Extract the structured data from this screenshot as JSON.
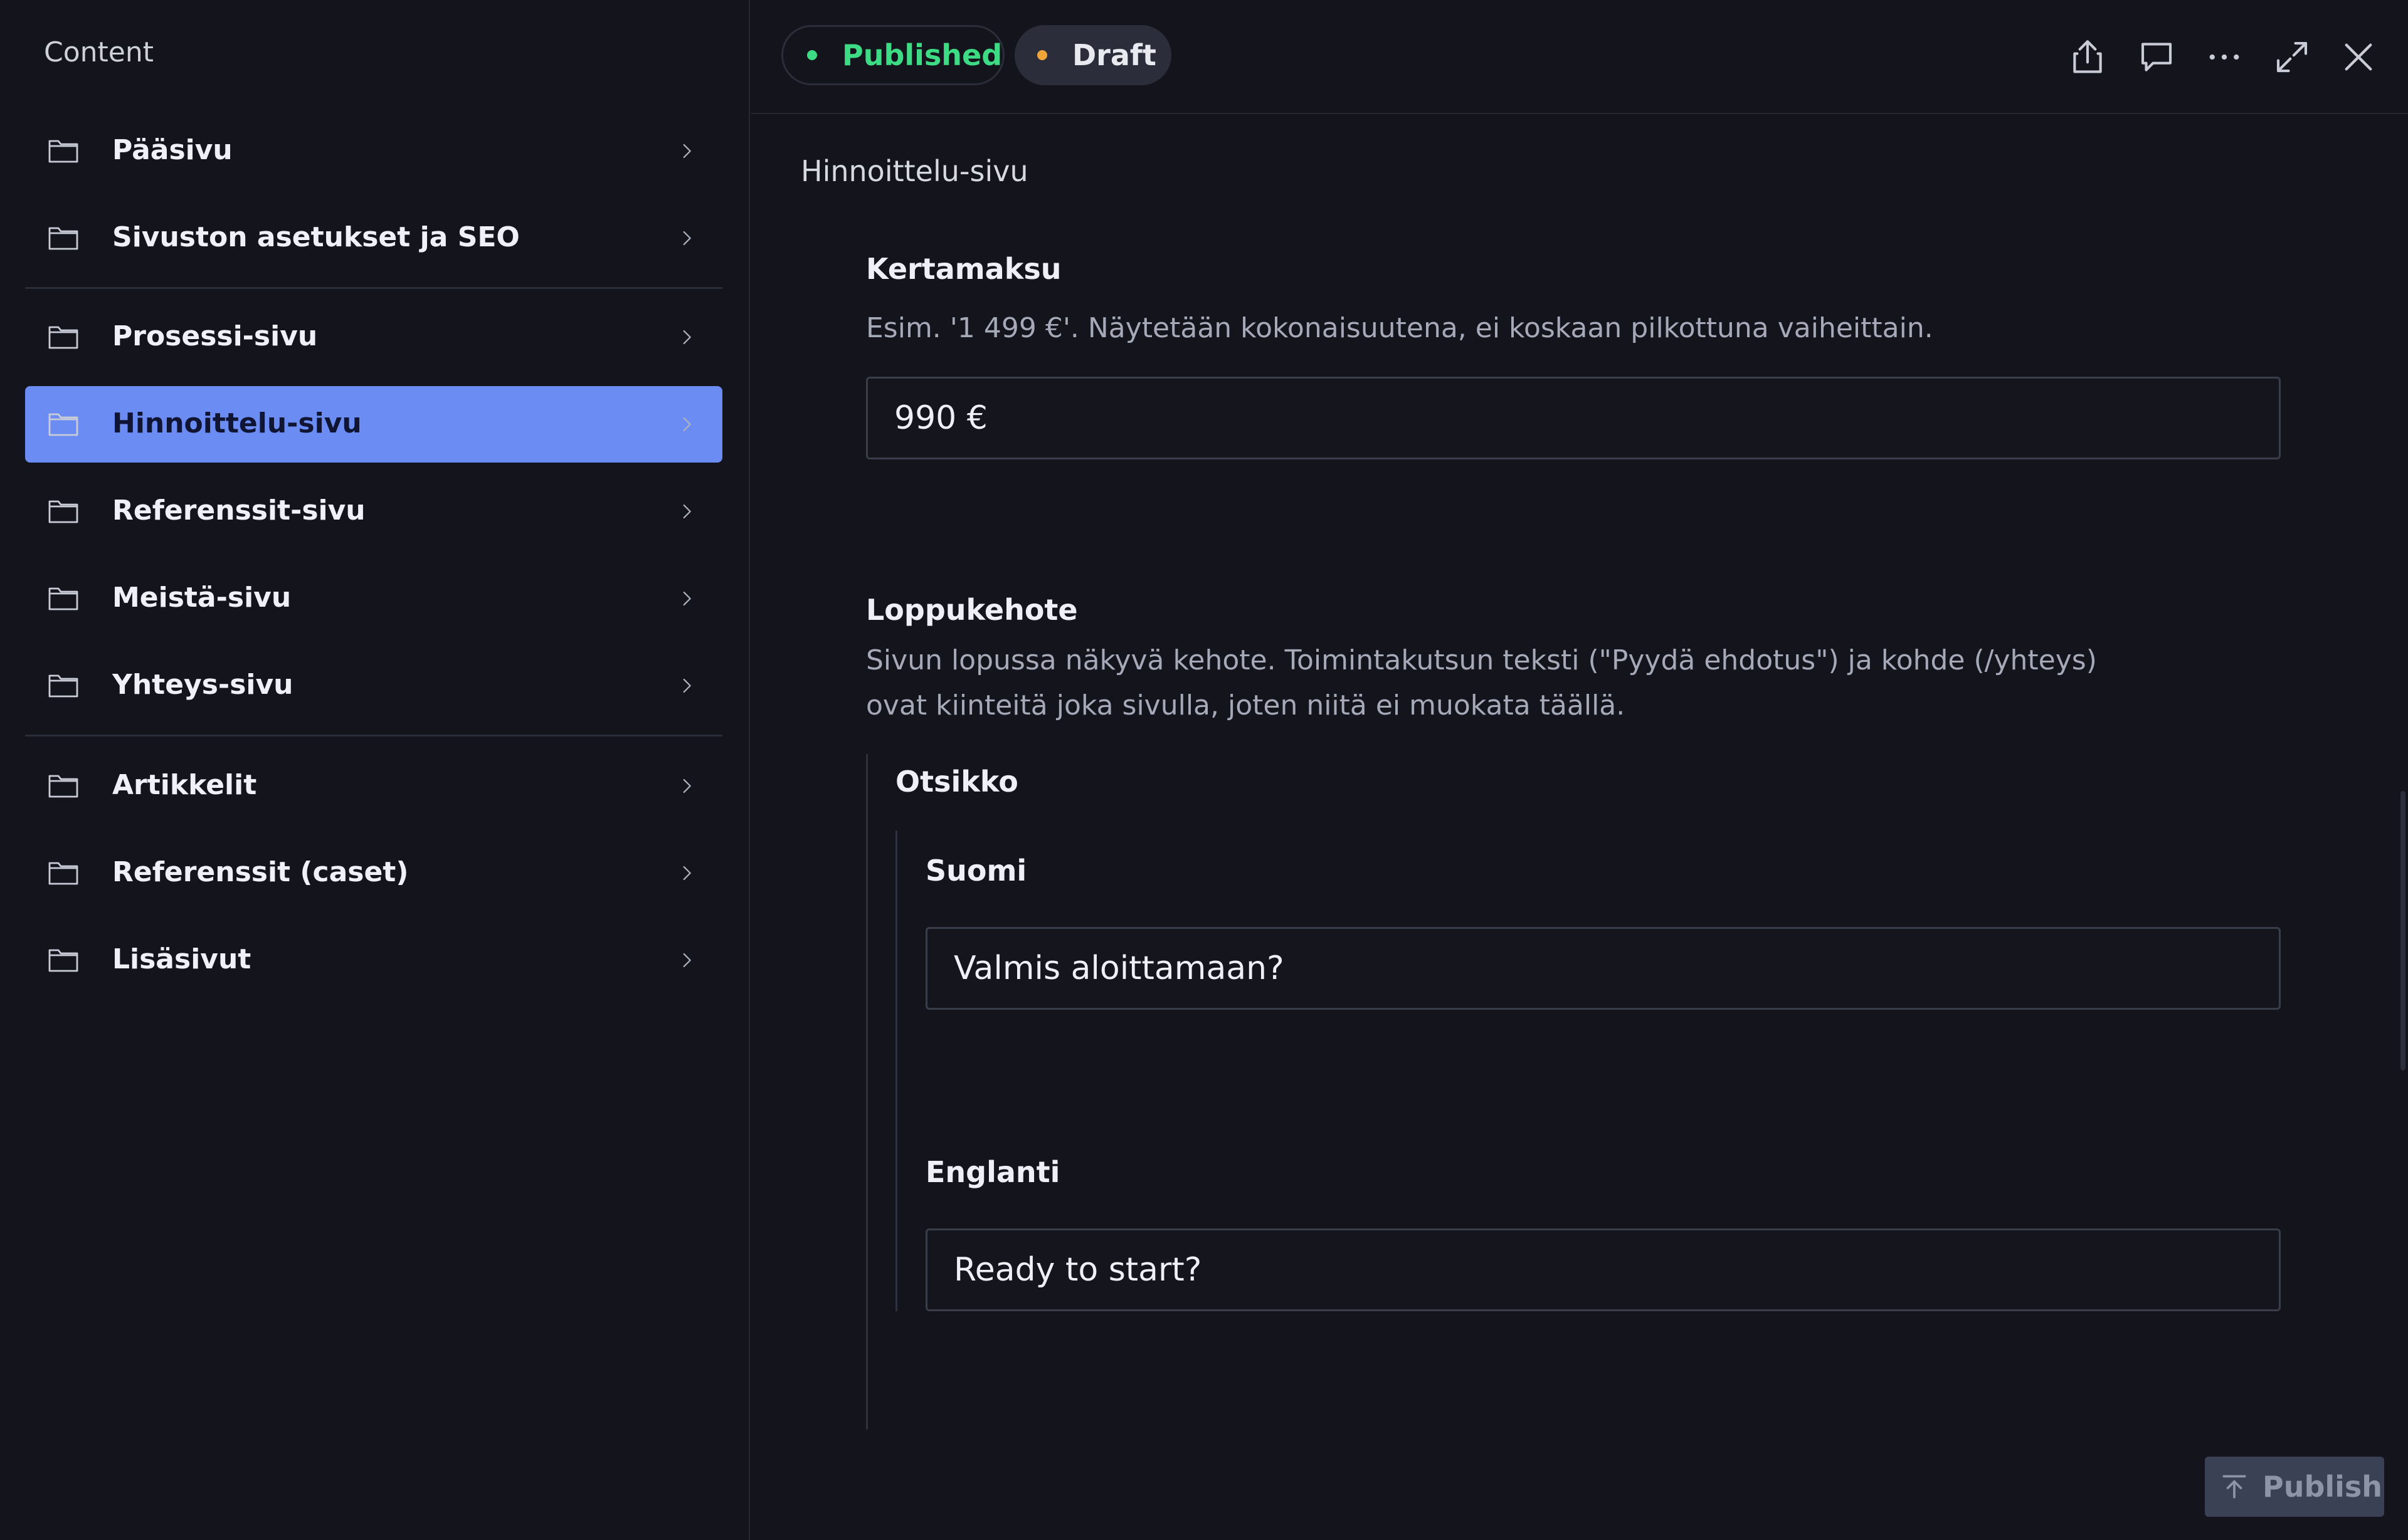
{
  "sidebar": {
    "title": "Content",
    "groups": [
      [
        {
          "label": "Pääsivu"
        },
        {
          "label": "Sivuston asetukset ja SEO"
        }
      ],
      [
        {
          "label": "Prosessi-sivu"
        },
        {
          "label": "Hinnoittelu-sivu",
          "active": true
        },
        {
          "label": "Referenssit-sivu"
        },
        {
          "label": "Meistä-sivu"
        },
        {
          "label": "Yhteys-sivu"
        }
      ],
      [
        {
          "label": "Artikkelit"
        },
        {
          "label": "Referenssit (caset)"
        },
        {
          "label": "Lisäsivut"
        }
      ]
    ],
    "icon": "folder-icon",
    "chevron_icon": "chevron-right-icon"
  },
  "topbar": {
    "published_label": "Published",
    "draft_label": "Draft",
    "published_color": "#3ddc84",
    "draft_color": "#f0a53b",
    "icons": [
      "share-icon",
      "comment-icon",
      "more-icon",
      "expand-icon",
      "close-icon"
    ]
  },
  "document": {
    "title": "Hinnoittelu-sivu",
    "kertamaksu": {
      "label": "Kertamaksu",
      "description": "Esim. '1 499 €'. Näytetään kokonaisuutena, ei koskaan pilkottuna vaiheittain.",
      "value": "990 €"
    },
    "loppukehote": {
      "label": "Loppukehote",
      "description_line1": "Sivun lopussa näkyvä kehote. Toimintakutsun teksti (\"Pyydä ehdotus\") ja kohde (/yhteys)",
      "description_line2": "ovat kiinteitä joka sivulla, joten niitä ei muokata täällä.",
      "otsikko": {
        "label": "Otsikko",
        "suomi": {
          "label": "Suomi",
          "value": "Valmis aloittamaan?"
        },
        "englanti": {
          "label": "Englanti",
          "value": "Ready to start?"
        }
      }
    }
  },
  "footer": {
    "publish_label": "Publish",
    "publish_icon": "publish-icon"
  },
  "colors": {
    "accent": "#6b8df3",
    "background": "#13141c"
  }
}
